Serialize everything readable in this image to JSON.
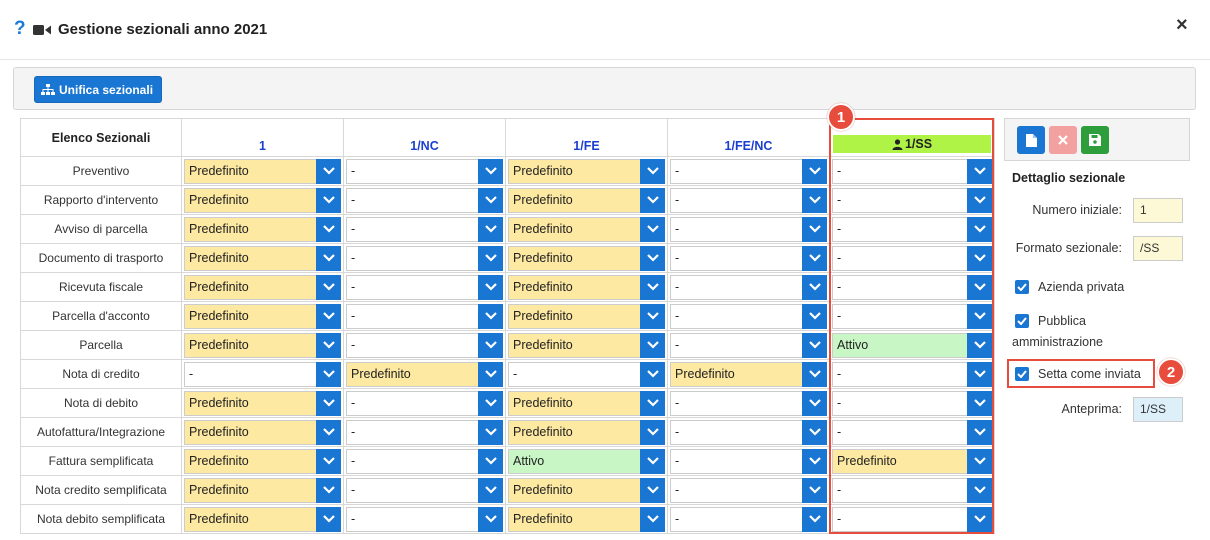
{
  "dialog": {
    "title": "Gestione sezionali anno 2021",
    "help_icon": "?",
    "close_icon": "×"
  },
  "toolbar": {
    "unifica_label": "Unifica sezionali"
  },
  "grid": {
    "corner_label": "Elenco Sezionali",
    "columns": [
      "1",
      "1/NC",
      "1/FE",
      "1/FE/NC",
      "1/SS"
    ],
    "rows": [
      {
        "label": "Preventivo",
        "values": [
          "Predefinito",
          "-",
          "Predefinito",
          "-",
          "-"
        ]
      },
      {
        "label": "Rapporto d'intervento",
        "values": [
          "Predefinito",
          "-",
          "Predefinito",
          "-",
          "-"
        ]
      },
      {
        "label": "Avviso di parcella",
        "values": [
          "Predefinito",
          "-",
          "Predefinito",
          "-",
          "-"
        ]
      },
      {
        "label": "Documento di trasporto",
        "values": [
          "Predefinito",
          "-",
          "Predefinito",
          "-",
          "-"
        ]
      },
      {
        "label": "Ricevuta fiscale",
        "values": [
          "Predefinito",
          "-",
          "Predefinito",
          "-",
          "-"
        ]
      },
      {
        "label": "Parcella d'acconto",
        "values": [
          "Predefinito",
          "-",
          "Predefinito",
          "-",
          "-"
        ]
      },
      {
        "label": "Parcella",
        "values": [
          "Predefinito",
          "-",
          "Predefinito",
          "-",
          "Attivo"
        ]
      },
      {
        "label": "Nota di credito",
        "values": [
          "-",
          "Predefinito",
          "-",
          "Predefinito",
          "-"
        ]
      },
      {
        "label": "Nota di debito",
        "values": [
          "Predefinito",
          "-",
          "Predefinito",
          "-",
          "-"
        ]
      },
      {
        "label": "Autofattura/Integrazione",
        "values": [
          "Predefinito",
          "-",
          "Predefinito",
          "-",
          "-"
        ]
      },
      {
        "label": "Fattura semplificata",
        "values": [
          "Predefinito",
          "-",
          "Attivo",
          "-",
          "Predefinito"
        ]
      },
      {
        "label": "Nota credito semplificata",
        "values": [
          "Predefinito",
          "-",
          "Predefinito",
          "-",
          "-"
        ]
      },
      {
        "label": "Nota debito semplificata",
        "values": [
          "Predefinito",
          "-",
          "Predefinito",
          "-",
          "-"
        ]
      }
    ]
  },
  "callouts": {
    "one": "1",
    "two": "2"
  },
  "detail": {
    "title": "Dettaglio sezionale",
    "numero_label": "Numero iniziale:",
    "numero_value": "1",
    "formato_label": "Formato sezionale:",
    "formato_value": "/SS",
    "azienda_label": "Azienda privata",
    "pubblica_label_1": "Pubblica",
    "pubblica_label_2": "amministrazione",
    "setta_label": "Setta come inviata",
    "anteprima_label": "Anteprima:",
    "anteprima_value": "1/SS"
  },
  "colors": {
    "primary": "#1976d2",
    "predefinito_bg": "#fde9a1",
    "attivo_bg": "#c8f7c5",
    "highlight_header": "#b0f347",
    "callout": "#e74c3c"
  }
}
